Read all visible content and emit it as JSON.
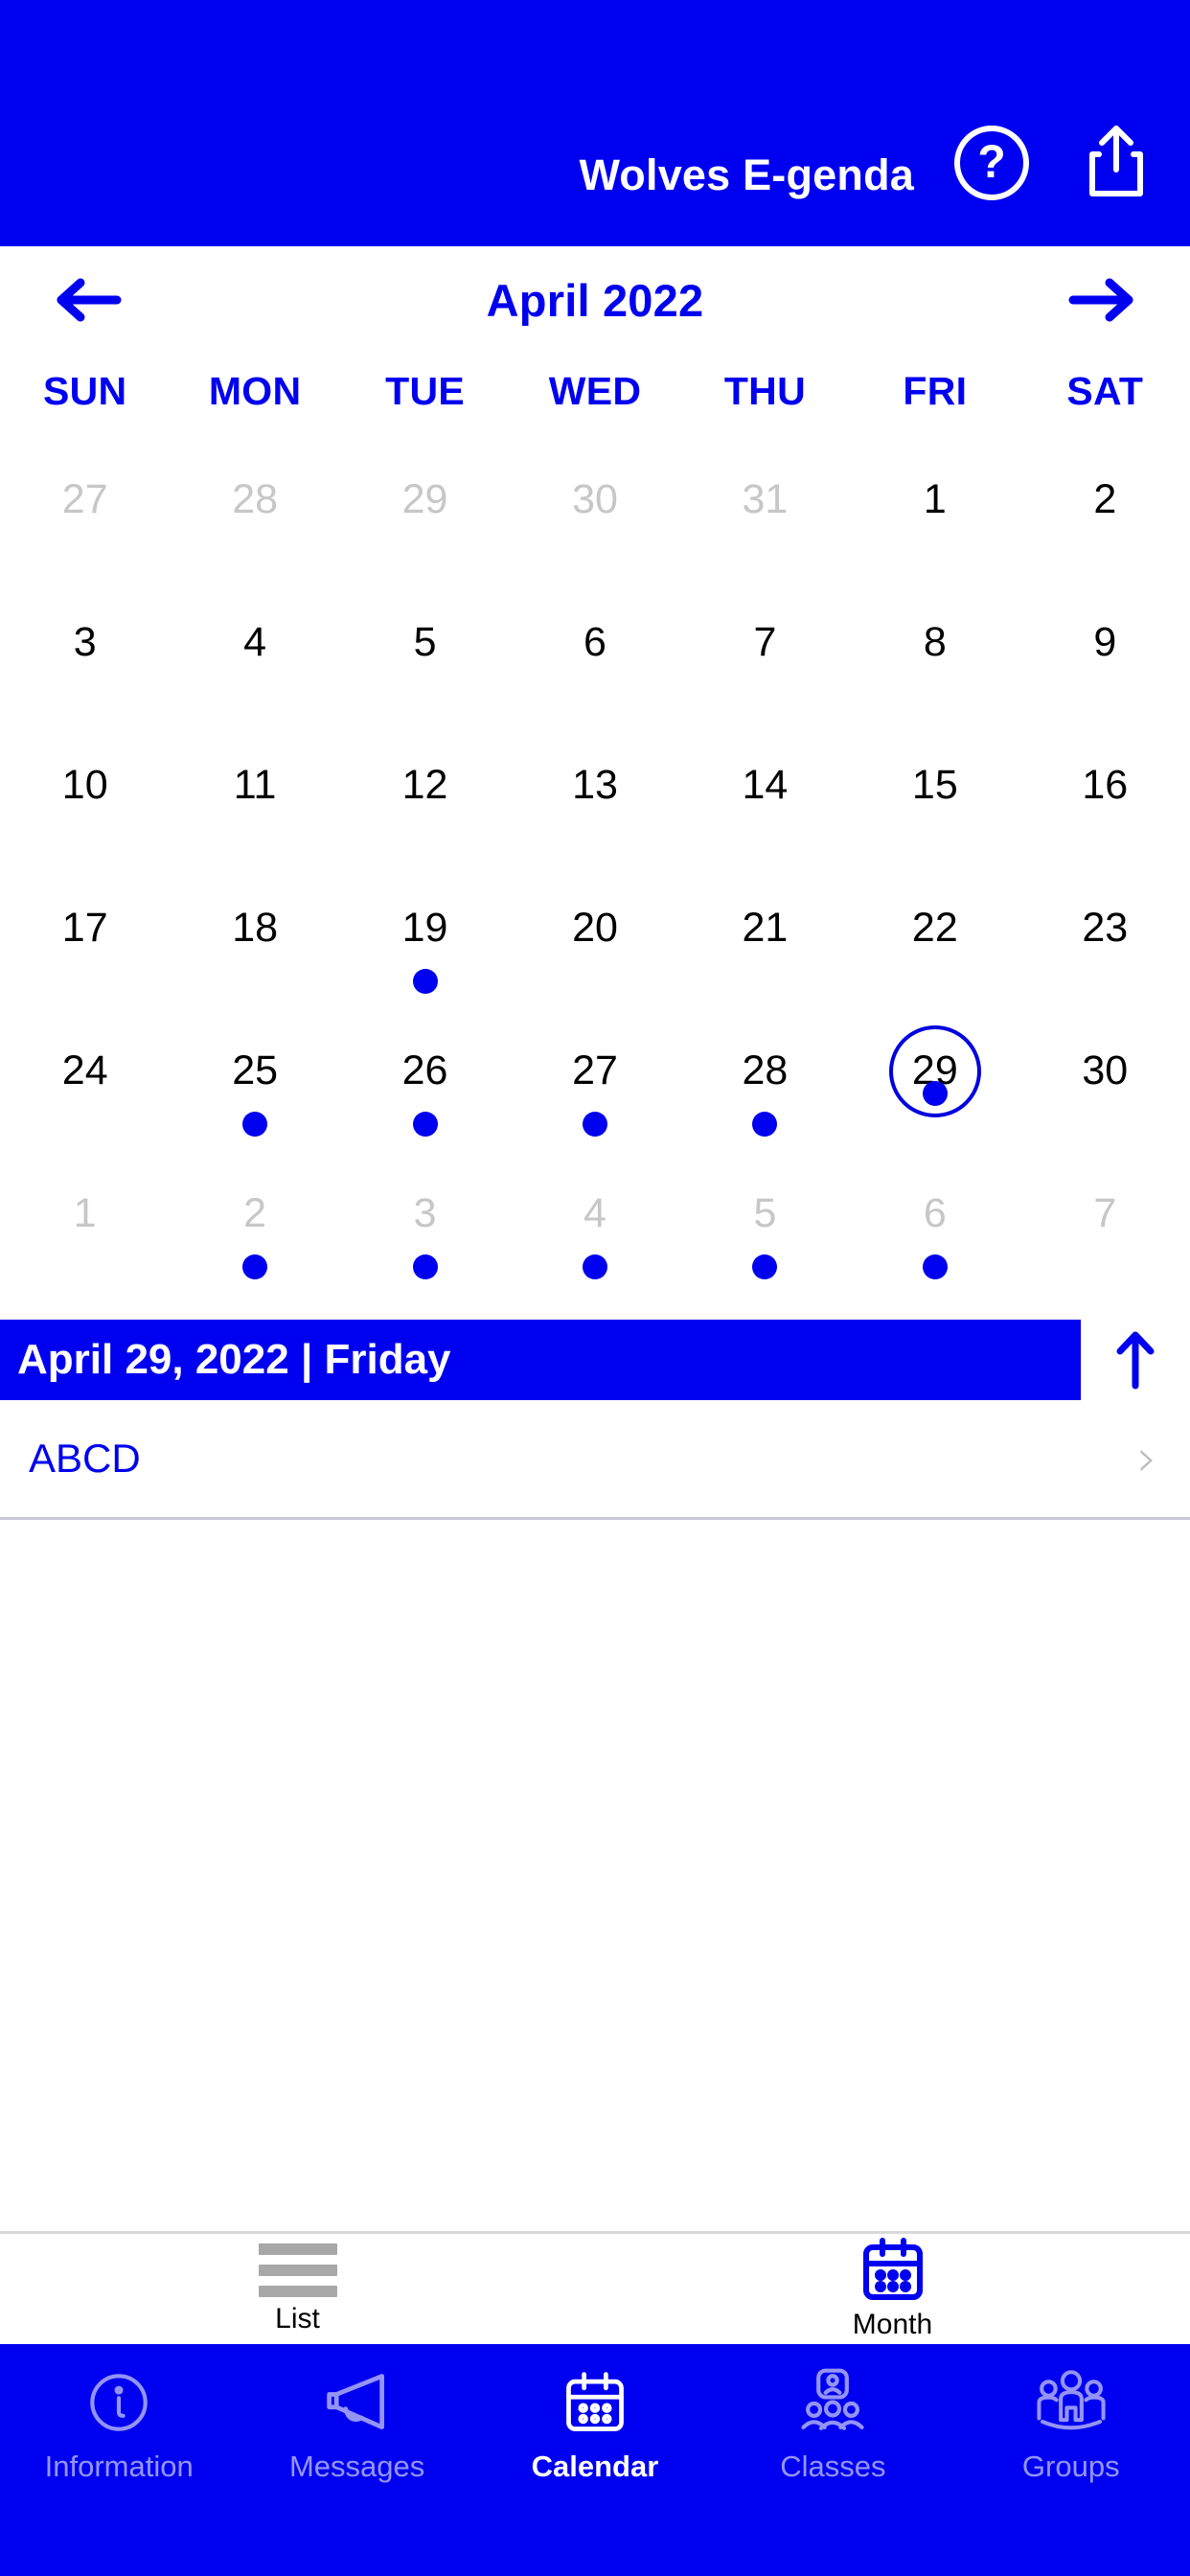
{
  "header": {
    "title": "Wolves E-genda",
    "help_label": "?",
    "help_icon": "question-mark-circle-icon",
    "share_icon": "share-upload-icon",
    "background_color": "#0000f0"
  },
  "month_nav": {
    "prev_icon": "arrow-left-icon",
    "next_icon": "arrow-right-icon",
    "month_label": "April 2022"
  },
  "weekdays": [
    "SUN",
    "MON",
    "TUE",
    "WED",
    "THU",
    "FRI",
    "SAT"
  ],
  "calendar": {
    "accent_color": "#0000f0",
    "muted_color": "#c7c7c7",
    "weeks": [
      [
        {
          "day": "27",
          "muted": true,
          "dot": false,
          "selected": false
        },
        {
          "day": "28",
          "muted": true,
          "dot": false,
          "selected": false
        },
        {
          "day": "29",
          "muted": true,
          "dot": false,
          "selected": false
        },
        {
          "day": "30",
          "muted": true,
          "dot": false,
          "selected": false
        },
        {
          "day": "31",
          "muted": true,
          "dot": false,
          "selected": false
        },
        {
          "day": "1",
          "muted": false,
          "dot": false,
          "selected": false
        },
        {
          "day": "2",
          "muted": false,
          "dot": false,
          "selected": false
        }
      ],
      [
        {
          "day": "3",
          "muted": false,
          "dot": false,
          "selected": false
        },
        {
          "day": "4",
          "muted": false,
          "dot": false,
          "selected": false
        },
        {
          "day": "5",
          "muted": false,
          "dot": false,
          "selected": false
        },
        {
          "day": "6",
          "muted": false,
          "dot": false,
          "selected": false
        },
        {
          "day": "7",
          "muted": false,
          "dot": false,
          "selected": false
        },
        {
          "day": "8",
          "muted": false,
          "dot": false,
          "selected": false
        },
        {
          "day": "9",
          "muted": false,
          "dot": false,
          "selected": false
        }
      ],
      [
        {
          "day": "10",
          "muted": false,
          "dot": false,
          "selected": false
        },
        {
          "day": "11",
          "muted": false,
          "dot": false,
          "selected": false
        },
        {
          "day": "12",
          "muted": false,
          "dot": false,
          "selected": false
        },
        {
          "day": "13",
          "muted": false,
          "dot": false,
          "selected": false
        },
        {
          "day": "14",
          "muted": false,
          "dot": false,
          "selected": false
        },
        {
          "day": "15",
          "muted": false,
          "dot": false,
          "selected": false
        },
        {
          "day": "16",
          "muted": false,
          "dot": false,
          "selected": false
        }
      ],
      [
        {
          "day": "17",
          "muted": false,
          "dot": false,
          "selected": false
        },
        {
          "day": "18",
          "muted": false,
          "dot": false,
          "selected": false
        },
        {
          "day": "19",
          "muted": false,
          "dot": true,
          "selected": false
        },
        {
          "day": "20",
          "muted": false,
          "dot": false,
          "selected": false
        },
        {
          "day": "21",
          "muted": false,
          "dot": false,
          "selected": false
        },
        {
          "day": "22",
          "muted": false,
          "dot": false,
          "selected": false
        },
        {
          "day": "23",
          "muted": false,
          "dot": false,
          "selected": false
        }
      ],
      [
        {
          "day": "24",
          "muted": false,
          "dot": false,
          "selected": false
        },
        {
          "day": "25",
          "muted": false,
          "dot": true,
          "selected": false
        },
        {
          "day": "26",
          "muted": false,
          "dot": true,
          "selected": false
        },
        {
          "day": "27",
          "muted": false,
          "dot": true,
          "selected": false
        },
        {
          "day": "28",
          "muted": false,
          "dot": true,
          "selected": false
        },
        {
          "day": "29",
          "muted": false,
          "dot": true,
          "selected": true
        },
        {
          "day": "30",
          "muted": false,
          "dot": false,
          "selected": false
        }
      ],
      [
        {
          "day": "1",
          "muted": true,
          "dot": false,
          "selected": false
        },
        {
          "day": "2",
          "muted": true,
          "dot": true,
          "selected": false
        },
        {
          "day": "3",
          "muted": true,
          "dot": true,
          "selected": false
        },
        {
          "day": "4",
          "muted": true,
          "dot": true,
          "selected": false
        },
        {
          "day": "5",
          "muted": true,
          "dot": true,
          "selected": false
        },
        {
          "day": "6",
          "muted": true,
          "dot": true,
          "selected": false
        },
        {
          "day": "7",
          "muted": true,
          "dot": false,
          "selected": false
        }
      ]
    ]
  },
  "selected_date_bar": {
    "text": "April 29, 2022 | Friday",
    "collapse_icon": "arrow-up-icon"
  },
  "events": [
    {
      "title": "ABCD",
      "chevron": "chevron-right-icon"
    }
  ],
  "view_switcher": {
    "items": [
      {
        "label": "List",
        "icon": "list-lines-icon",
        "active": false
      },
      {
        "label": "Month",
        "icon": "calendar-icon",
        "active": true
      }
    ]
  },
  "tabbar": {
    "items": [
      {
        "label": "Information",
        "icon": "info-circle-icon",
        "active": false
      },
      {
        "label": "Messages",
        "icon": "megaphone-icon",
        "active": false
      },
      {
        "label": "Calendar",
        "icon": "calendar-icon",
        "active": true
      },
      {
        "label": "Classes",
        "icon": "classroom-icon",
        "active": false
      },
      {
        "label": "Groups",
        "icon": "people-group-icon",
        "active": false
      }
    ]
  }
}
